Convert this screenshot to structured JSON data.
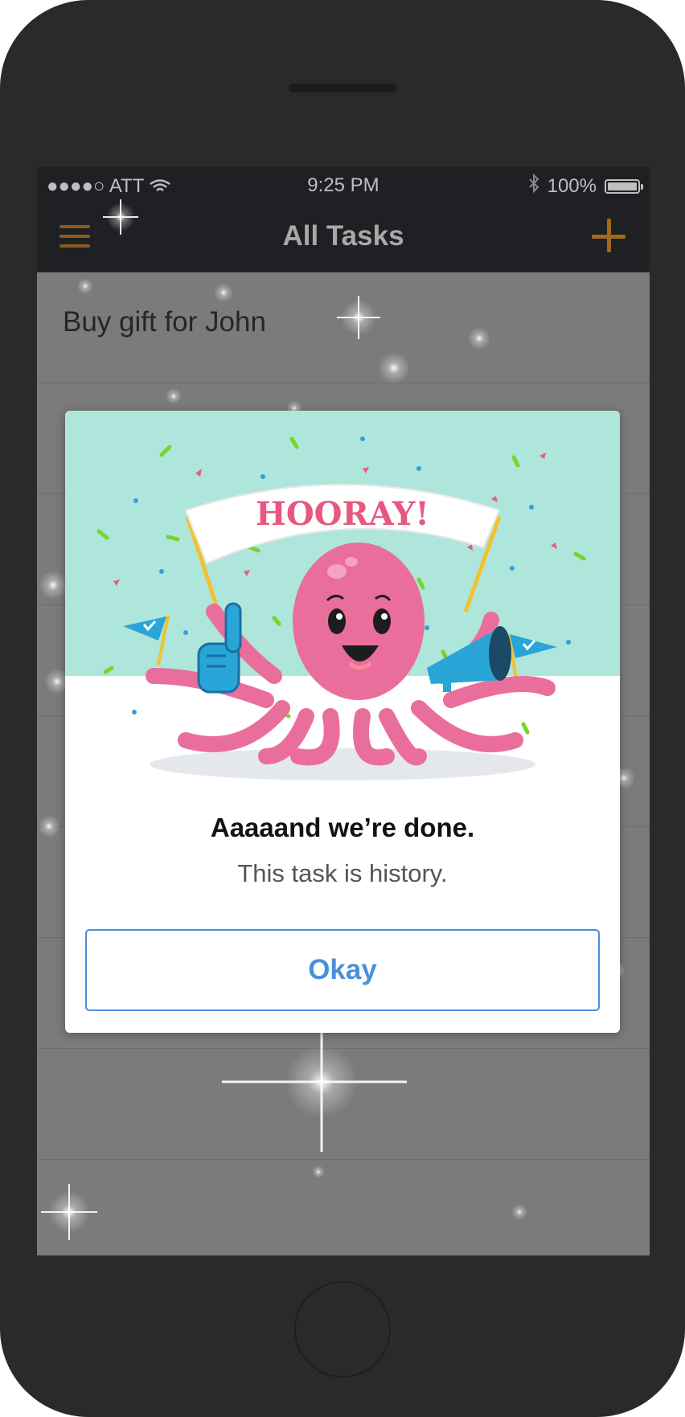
{
  "status_bar": {
    "signal_dots": "●●●●○",
    "carrier": "ATT",
    "time": "9:25 PM",
    "battery_text": "100%",
    "battery_level": 1.0
  },
  "nav_bar": {
    "title": "All Tasks",
    "menu_icon": "hamburger-menu-icon",
    "add_icon": "plus-icon",
    "accent_color": "#a06a1e"
  },
  "task_list": {
    "items": [
      {
        "label": "Buy gift for John"
      }
    ]
  },
  "dialog": {
    "banner_text": "HOORAY!",
    "title": "Aaaaand we’re done.",
    "subtitle": "This task is history.",
    "button_label": "Okay",
    "button_color": "#4a90d9",
    "illustration": "octopus-celebration-illustration"
  }
}
